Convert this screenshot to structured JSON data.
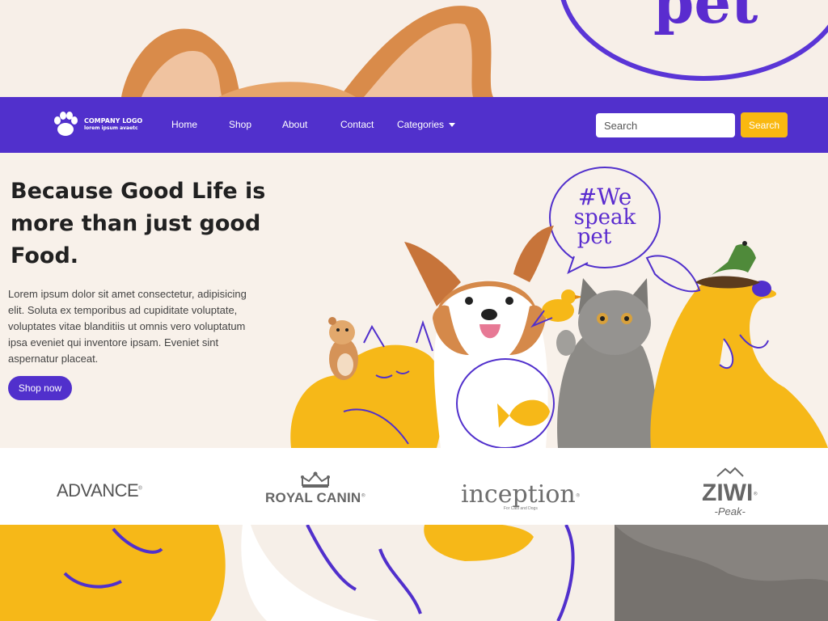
{
  "top_banner": {
    "bubble_text": "pet"
  },
  "navbar": {
    "logo": {
      "line1": "COMPANY LOGO",
      "line2": "lorem ipsum avaetc",
      "icon": "paw-icon"
    },
    "links": [
      {
        "label": "Home"
      },
      {
        "label": "Shop"
      },
      {
        "label": "About"
      },
      {
        "label": "Contact"
      },
      {
        "label": "Categories",
        "icon": "caret-down-icon"
      }
    ],
    "search": {
      "placeholder": "Search",
      "button_label": "Search"
    }
  },
  "hero": {
    "headline": "Because Good Life is more than just good Food.",
    "body": "Lorem ipsum dolor sit amet consectetur, adipisicing elit. Soluta ex temporibus ad cupiditate voluptate, voluptates vitae blanditiis ut omnis vero voluptatum ipsa eveniet qui inventore ipsam. Eveniet sint aspernatur placeat.",
    "cta_label": "Shop now",
    "bubble_lines": [
      "#We",
      "speak",
      "pet"
    ]
  },
  "brands": [
    {
      "name": "ADVANCE",
      "mark": "®"
    },
    {
      "name": "ROYAL CANIN",
      "mark": "®"
    },
    {
      "name": "inception",
      "mark": "®",
      "tagline": "For Cats and Dogs"
    },
    {
      "name": "ZIWI",
      "mark": "®",
      "subline": "-Peak-"
    }
  ],
  "colors": {
    "primary": "#5130cc",
    "accent_yellow": "#f9b810",
    "hero_bg": "#f8f1ea",
    "text_dark": "#212121"
  }
}
